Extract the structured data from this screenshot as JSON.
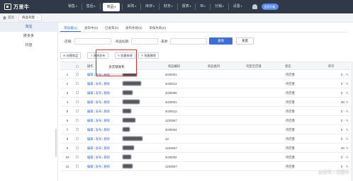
{
  "app": {
    "logo_text": "万里牛",
    "nav": [
      "销售",
      "售后",
      "商品",
      "采购",
      "库存",
      "财务",
      "报表",
      "BI",
      "分销",
      "设置"
    ],
    "nav_active_index": 2,
    "upgrade_label": "会员升级"
  },
  "tabs": {
    "home_label": "首页",
    "page_tab_label": "商品刊登",
    "close_glyph": "×"
  },
  "sidebar": {
    "items": [
      "淘宝",
      "拼多多",
      "抖店"
    ],
    "active_index": 0
  },
  "status_tabs": [
    "审核箱(1)",
    "发布中(0)",
    "已发布(0)",
    "发布失败(0)",
    "审核失败(0)"
  ],
  "status_tabs_active_index": 0,
  "filters": {
    "store_label": "店铺:",
    "title_label": "商品标题:",
    "source_label": "来源:",
    "query_button": "查询",
    "reset_button": "重置"
  },
  "toolbar": {
    "create_label": "创建商品",
    "publish_label": "直接发布",
    "batch_edit_label": "批量修改",
    "batch_delete_label": "批量删除"
  },
  "dropdown": {
    "multi_store_publish": "多店铺发布"
  },
  "table": {
    "columns": [
      "操作",
      "标题",
      "商品编码",
      "商品类目",
      "刊登至店铺",
      "状态",
      "库存"
    ],
    "op_edit": "编辑",
    "op_publish": "发布",
    "op_delete": "删除",
    "op_sep": "|",
    "rows": [
      {
        "no": "1",
        "code": "3c00001",
        "status": "待完善",
        "stock": "0"
      },
      {
        "no": "2",
        "code": "3c00013",
        "status": "待完善",
        "stock": "0"
      },
      {
        "no": "3",
        "code": "3c00005",
        "status": "待完善",
        "stock": "0"
      },
      {
        "no": "4",
        "code": "3c00001",
        "status": "待完善",
        "stock": "20"
      },
      {
        "no": "5",
        "code": "3c00012",
        "status": "待完善",
        "stock": "0"
      },
      {
        "no": "6",
        "code": "1234567",
        "status": "待完善",
        "stock": "0"
      },
      {
        "no": "7",
        "code": "3c00004",
        "status": "待完善",
        "stock": "0"
      },
      {
        "no": "8",
        "code": "13",
        "status": "待完善",
        "stock": "0"
      },
      {
        "no": "9",
        "code": "1234567",
        "status": "待完善",
        "stock": "20"
      },
      {
        "no": "10",
        "code": "3c00002",
        "status": "待完善",
        "stock": "0"
      },
      {
        "no": "11",
        "code": "1234567",
        "status": "待完善",
        "stock": "0"
      }
    ]
  },
  "watermark": "头条号 / 万里牛"
}
